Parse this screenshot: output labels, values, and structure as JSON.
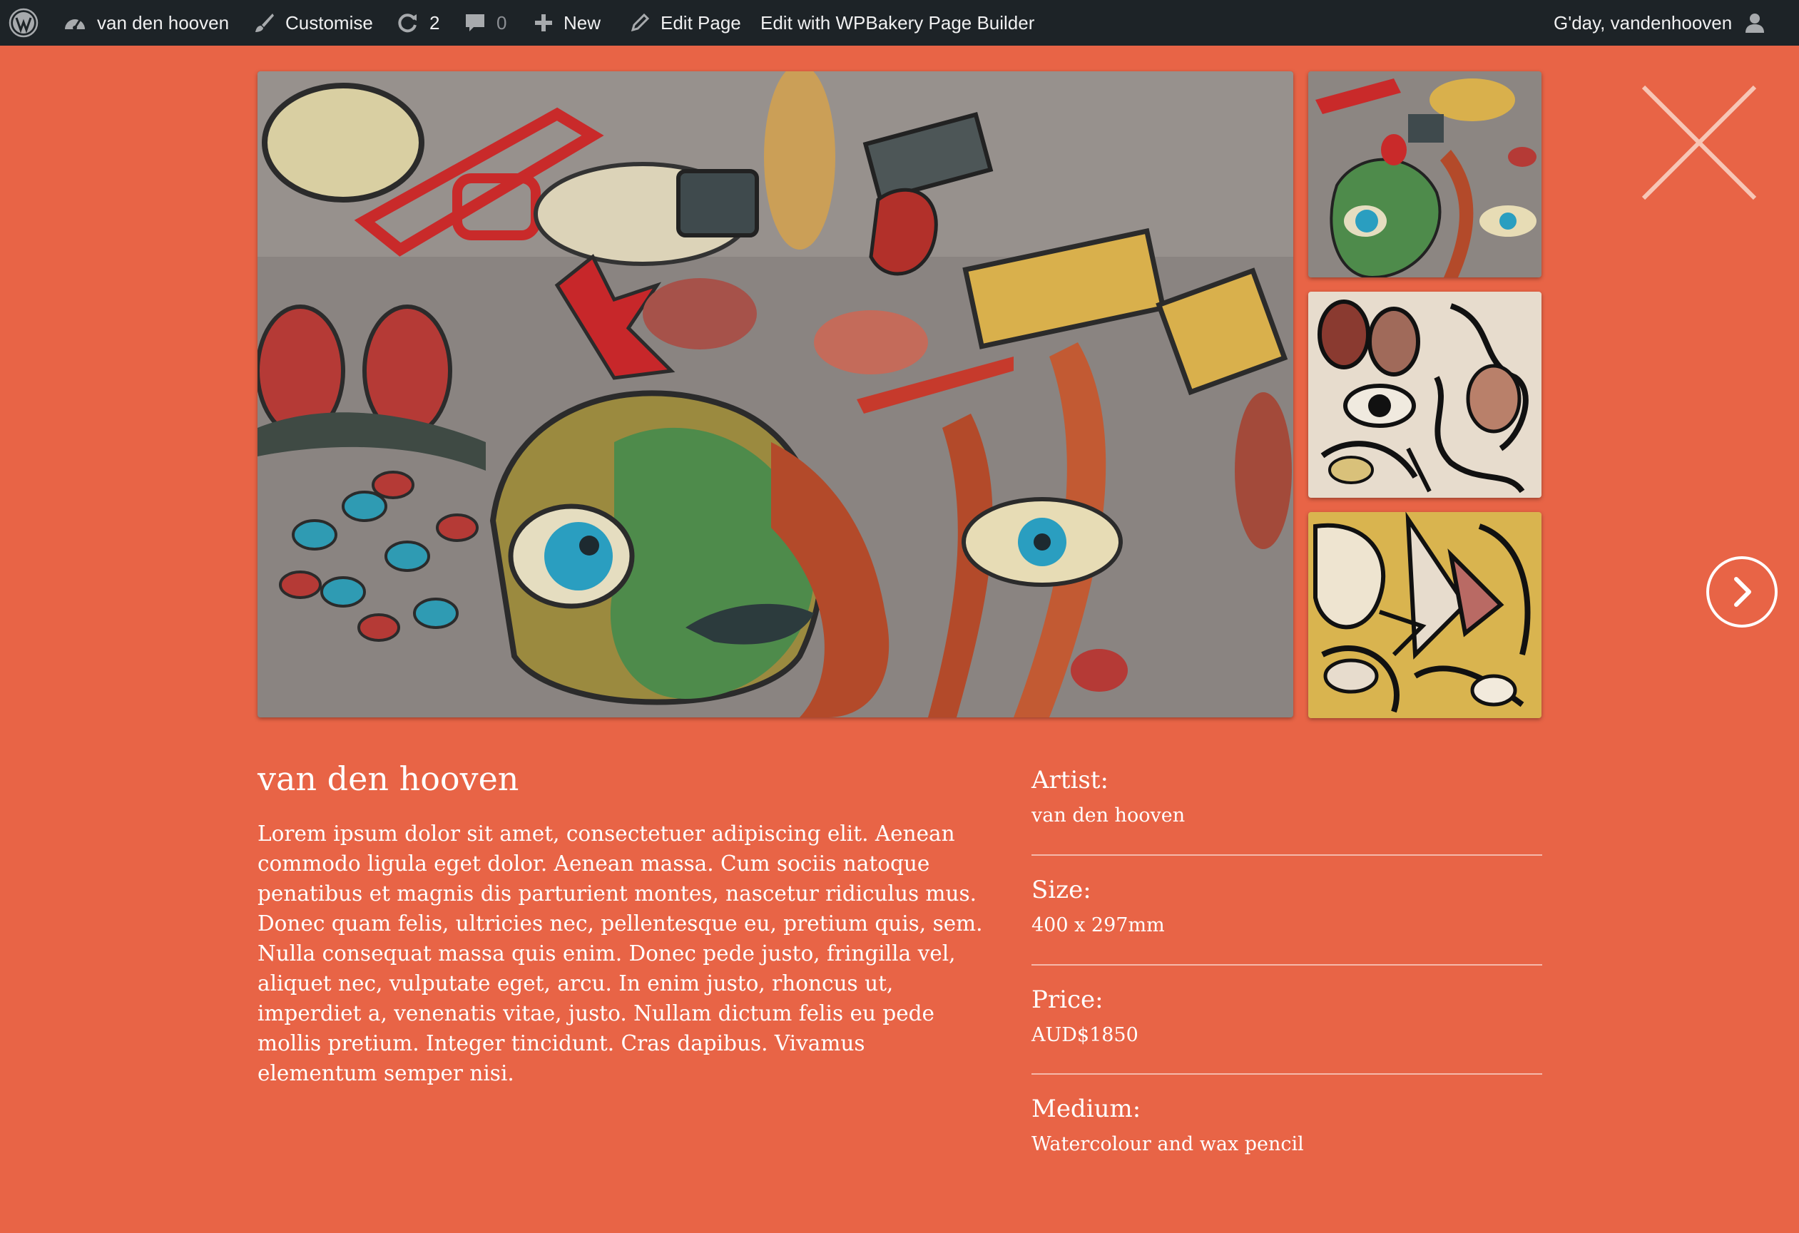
{
  "adminbar": {
    "site_name": "van den hooven",
    "customise": "Customise",
    "updates_count": "2",
    "comments_count": "0",
    "new_label": "New",
    "edit_page": "Edit Page",
    "edit_builder": "Edit with WPBakery Page Builder",
    "greeting": "G'day, vandenhooven"
  },
  "artwork": {
    "title": "van den hooven",
    "description": "Lorem ipsum dolor sit amet, consectetuer adipiscing elit. Aenean commodo ligula eget dolor. Aenean massa. Cum sociis natoque penatibus et magnis dis parturient montes, nascetur ridiculus mus. Donec quam felis, ultricies nec, pellentesque eu, pretium quis, sem. Nulla consequat massa quis enim. Donec pede justo, fringilla vel, aliquet nec, vulputate eget, arcu. In enim justo, rhoncus ut, imperdiet a, venenatis vitae, justo. Nullam dictum felis eu pede mollis pretium. Integer tincidunt. Cras dapibus. Vivamus elementum semper nisi.",
    "details": [
      {
        "label": "Artist:",
        "value": "van den hooven"
      },
      {
        "label": "Size:",
        "value": "400 x 297mm"
      },
      {
        "label": "Price:",
        "value": "AUD$1850"
      },
      {
        "label": "Medium:",
        "value": "Watercolour and wax pencil"
      }
    ]
  },
  "icons": {
    "wordpress": "wordpress-logo-icon",
    "dashboard": "dashboard-icon",
    "customise": "paintbrush-icon",
    "updates": "refresh-icon",
    "comments": "comment-icon",
    "new": "plus-icon",
    "edit": "pencil-icon",
    "user": "user-icon",
    "close": "close-icon",
    "next": "chevron-right-icon"
  },
  "colors": {
    "page_background": "#e86446",
    "adminbar": "#1d2327",
    "text": "#ffffff"
  }
}
